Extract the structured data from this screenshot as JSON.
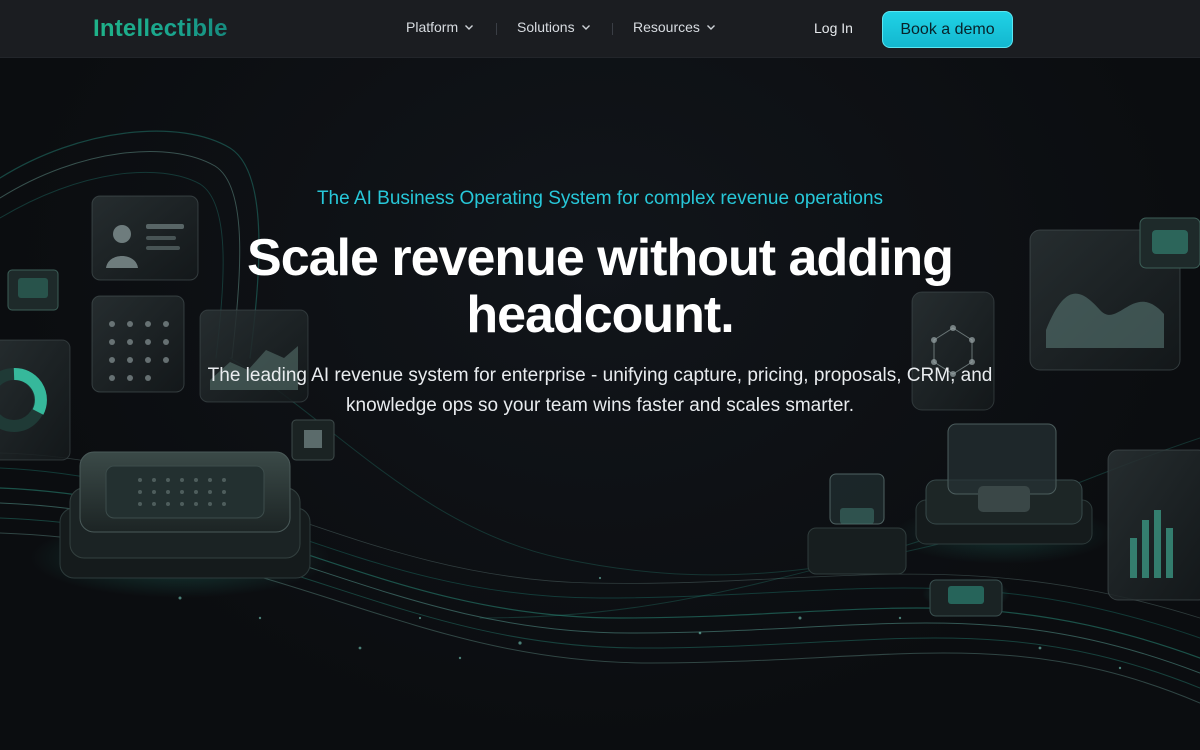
{
  "nav": {
    "logo": "Intellectible",
    "items": [
      {
        "label": "Platform"
      },
      {
        "label": "Solutions"
      },
      {
        "label": "Resources"
      }
    ],
    "login_label": "Log In",
    "cta_label": "Book a demo"
  },
  "hero": {
    "eyebrow": "The AI Business Operating System for complex revenue operations",
    "headline": "Scale revenue without adding headcount.",
    "subheadline": "The leading AI revenue system for enterprise - unifying capture, pricing, proposals, CRM, and knowledge ops so your team wins faster and scales smarter."
  },
  "colors": {
    "accent": "#1fb389",
    "cta": "#13b7cf",
    "eyebrow": "#27c7d8",
    "background": "#0c0e11"
  }
}
